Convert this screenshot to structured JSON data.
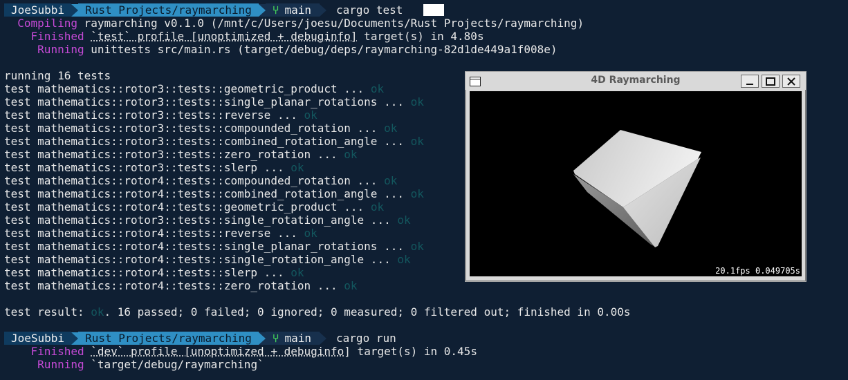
{
  "prompt1": {
    "user": "JoeSubbi",
    "path": "Rust Projects/raymarching",
    "branch_glyph": "⑂",
    "branch": "main",
    "command": "cargo test"
  },
  "compile": {
    "compiling_label": "Compiling",
    "compiling_text": "raymarching v0.1.0 (/mnt/c/Users/joesu/Documents/Rust Projects/raymarching)",
    "finished_label": "Finished",
    "finished_text1": "`test` profile [unoptimized + debuginfo]",
    "finished_text2": " target(s) in 4.80s",
    "running_label": "Running",
    "running_text": "unittests src/main.rs (target/debug/deps/raymarching-82d1de449a1f008e)"
  },
  "running_tests": "running 16 tests",
  "tests": [
    {
      "text": "test mathematics::rotor3::tests::geometric_product ... ",
      "status": "ok"
    },
    {
      "text": "test mathematics::rotor3::tests::single_planar_rotations ... ",
      "status": "ok"
    },
    {
      "text": "test mathematics::rotor3::tests::reverse ... ",
      "status": "ok"
    },
    {
      "text": "test mathematics::rotor3::tests::compounded_rotation ... ",
      "status": "ok"
    },
    {
      "text": "test mathematics::rotor3::tests::combined_rotation_angle ... ",
      "status": "ok"
    },
    {
      "text": "test mathematics::rotor3::tests::zero_rotation ... ",
      "status": "ok"
    },
    {
      "text": "test mathematics::rotor3::tests::slerp ... ",
      "status": "ok"
    },
    {
      "text": "test mathematics::rotor4::tests::compounded_rotation ... ",
      "status": "ok"
    },
    {
      "text": "test mathematics::rotor4::tests::combined_rotation_angle ... ",
      "status": "ok"
    },
    {
      "text": "test mathematics::rotor4::tests::geometric_product ... ",
      "status": "ok"
    },
    {
      "text": "test mathematics::rotor3::tests::single_rotation_angle ... ",
      "status": "ok"
    },
    {
      "text": "test mathematics::rotor4::tests::reverse ... ",
      "status": "ok"
    },
    {
      "text": "test mathematics::rotor4::tests::single_planar_rotations ... ",
      "status": "ok"
    },
    {
      "text": "test mathematics::rotor4::tests::single_rotation_angle ... ",
      "status": "ok"
    },
    {
      "text": "test mathematics::rotor4::tests::slerp ... ",
      "status": "ok"
    },
    {
      "text": "test mathematics::rotor4::tests::zero_rotation ... ",
      "status": "ok"
    }
  ],
  "result": {
    "prefix": "test result: ",
    "status": "ok",
    "rest": ". 16 passed; 0 failed; 0 ignored; 0 measured; 0 filtered out; finished in 0.00s"
  },
  "prompt2": {
    "user": "JoeSubbi",
    "path": "Rust Projects/raymarching",
    "branch_glyph": "⑂",
    "branch": "main",
    "command": "cargo run"
  },
  "run": {
    "finished_label": "Finished",
    "finished_text1": "`dev` profile [unoptimized + debuginfo]",
    "finished_text2": " target(s) in 0.45s",
    "running_label": "Running",
    "running_text": "`target/debug/raymarching`"
  },
  "window": {
    "title": "4D Raymarching",
    "fps": "20.1fps 0.049705s"
  },
  "colors": {
    "background": "#0f1f33",
    "ok": "#13575e",
    "label": "#c54ad6",
    "git": "#46d85a"
  }
}
